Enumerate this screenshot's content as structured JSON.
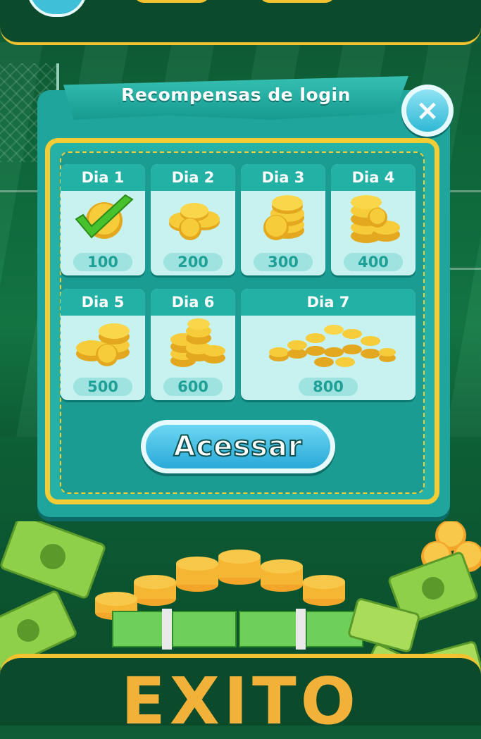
{
  "modal": {
    "title": "Recompensas de login",
    "close_label": "×",
    "button_label": "Acessar"
  },
  "days": [
    {
      "label": "Dia 1",
      "amount": "100",
      "claimed": true
    },
    {
      "label": "Dia 2",
      "amount": "200",
      "claimed": false
    },
    {
      "label": "Dia 3",
      "amount": "300",
      "claimed": false
    },
    {
      "label": "Dia 4",
      "amount": "400",
      "claimed": false
    },
    {
      "label": "Dia 5",
      "amount": "500",
      "claimed": false
    },
    {
      "label": "Dia 6",
      "amount": "600",
      "claimed": false
    },
    {
      "label": "Dia 7",
      "amount": "800",
      "claimed": false
    }
  ],
  "footer": {
    "brand": "EXITO"
  },
  "colors": {
    "accent": "#f4cc35",
    "panel": "#1fa59b",
    "button": "#2aa9d8"
  }
}
